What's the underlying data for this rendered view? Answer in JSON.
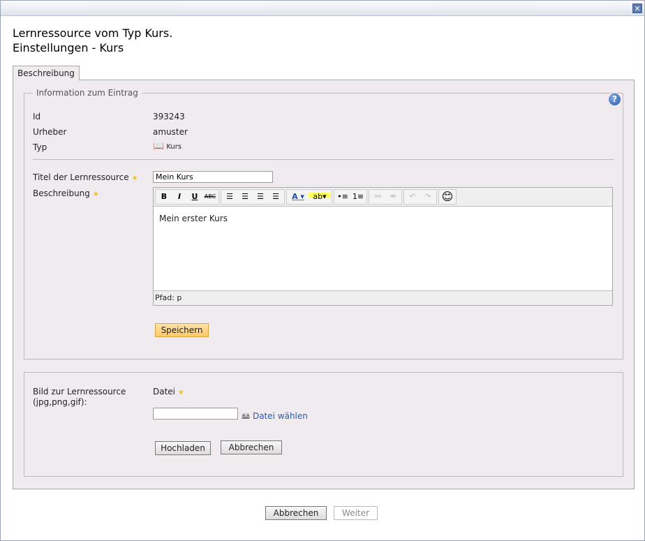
{
  "window": {
    "close_icon": "close-icon"
  },
  "header": {
    "line1": "Lernressource vom Typ Kurs.",
    "line2": "Einstellungen - Kurs"
  },
  "tabs": [
    {
      "label": "Beschreibung",
      "active": true
    }
  ],
  "info": {
    "legend": "Information zum Eintrag",
    "id_label": "Id",
    "id_value": "393243",
    "author_label": "Urheber",
    "author_value": "amuster",
    "type_label": "Typ",
    "type_value": "Kurs"
  },
  "form": {
    "title_label": "Titel der Lernressource",
    "title_value": "Mein Kurs",
    "desc_label": "Beschreibung",
    "desc_value": "Mein erster Kurs",
    "path": "Pfad: p",
    "save": "Speichern",
    "toolbar": [
      "B",
      "I",
      "U",
      "ABC"
    ]
  },
  "image": {
    "label": "Bild zur Lernressource (jpg,png,gif):",
    "file_label": "Datei",
    "choose": "Datei wählen",
    "upload": "Hochladen",
    "cancel": "Abbrechen"
  },
  "footer": {
    "cancel": "Abbrechen",
    "next": "Weiter"
  }
}
